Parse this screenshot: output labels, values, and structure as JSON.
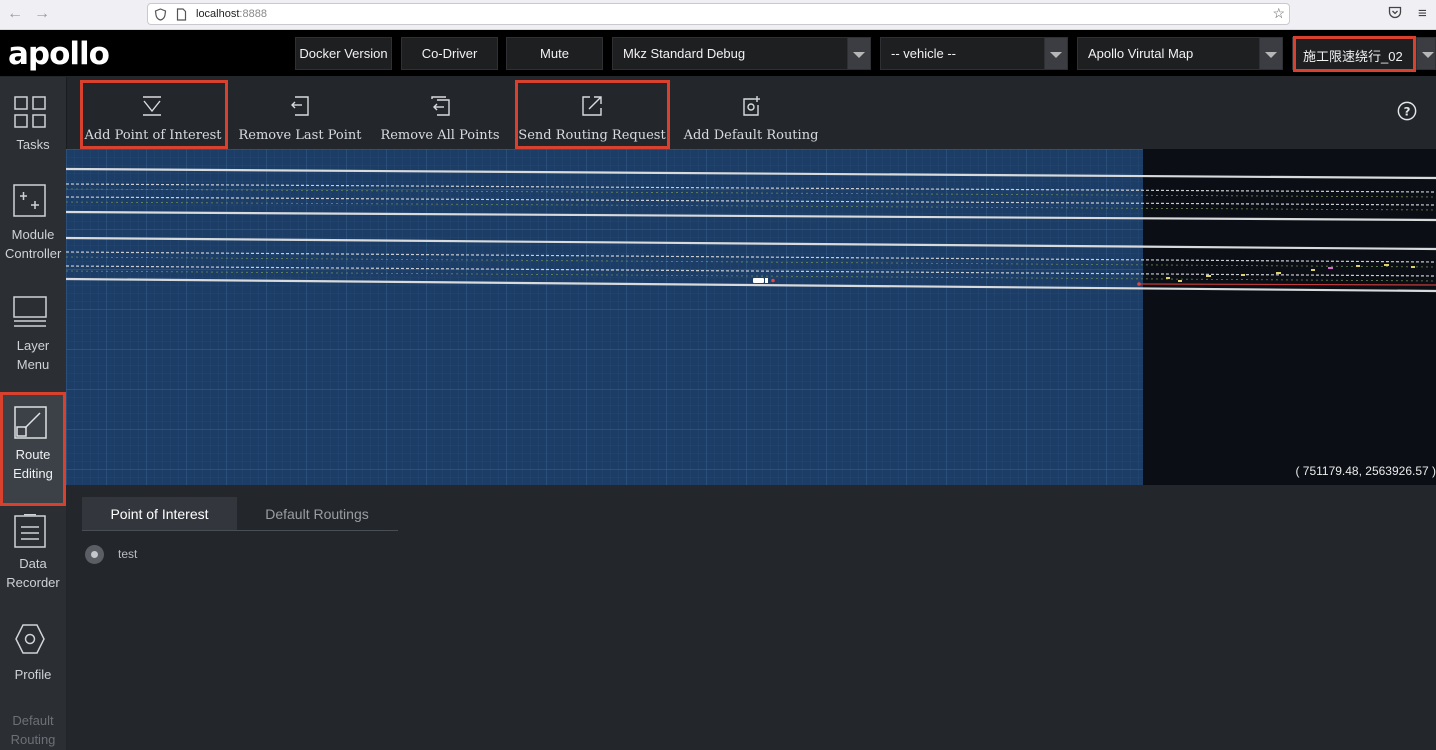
{
  "browser": {
    "host": "localhost",
    "port": ":8888"
  },
  "header": {
    "logo": "apollo",
    "buttons": [
      "Docker Version",
      "Co-Driver",
      "Mute"
    ],
    "mode_select": "Mkz Standard Debug",
    "vehicle_select": "-- vehicle --",
    "map_select": "Apollo Virutal Map",
    "scenario_select": "施工限速绕行_02"
  },
  "sidebar": {
    "items": [
      {
        "label": "Tasks"
      },
      {
        "label": "Module Controller"
      },
      {
        "label": "Layer Menu"
      },
      {
        "label": "Route Editing"
      },
      {
        "label": "Data Recorder"
      },
      {
        "label": "Profile"
      },
      {
        "label": "Default Routing"
      }
    ]
  },
  "toolbar": {
    "tools": [
      {
        "label": "Add Point of Interest"
      },
      {
        "label": "Remove Last Point"
      },
      {
        "label": "Remove All Points"
      },
      {
        "label": "Send Routing Request"
      },
      {
        "label": "Add Default Routing"
      }
    ]
  },
  "map": {
    "coordinates": "( 751179.48, 2563926.57 )"
  },
  "panel": {
    "tabs": [
      "Point of Interest",
      "Default Routings"
    ],
    "points": [
      "test"
    ]
  },
  "colors": {
    "highlight": "#d9412f",
    "grid_area": "#1b3d66",
    "header_bg": "#000000",
    "sidebar_bg": "#2b2e33"
  }
}
